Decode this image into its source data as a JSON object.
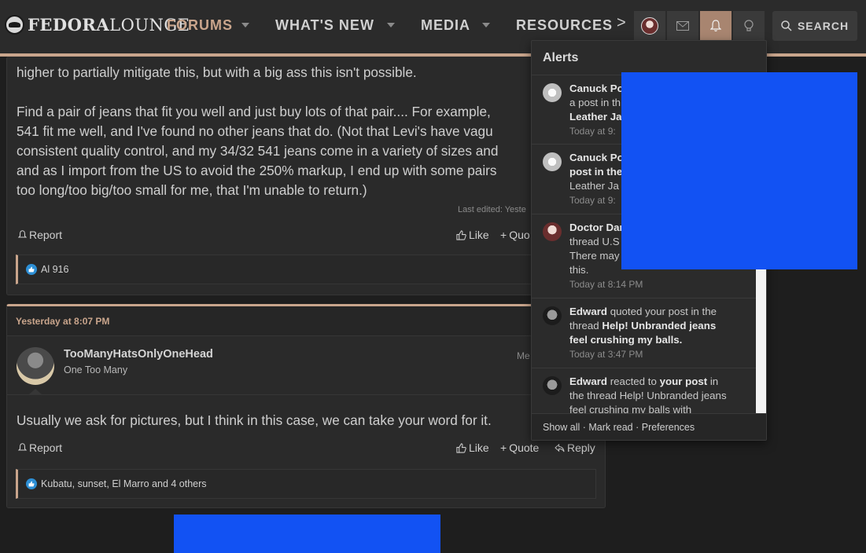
{
  "brand": {
    "logo_part1": "FEDORA",
    "logo_part2": "LOUNGE"
  },
  "nav": {
    "items": [
      "FORUMS",
      "WHAT'S NEW",
      "MEDIA",
      "RESOURCES"
    ],
    "more": ">",
    "search_label": "SEARCH"
  },
  "post1": {
    "lines": [
      "higher to partially mitigate this, but with a big ass this isn't possible.",
      "",
      "Find a pair of jeans that fit you well and just buy lots of that pair.... For example,",
      "541 fit me well, and I've found no other jeans that do. (Not that Levi's have vagu",
      "consistent quality control, and my 34/32 541 jeans come in a variety of sizes and",
      "and as I import from the US to avoid the 250% markup, I end up with some pairs",
      "too long/too big/too small for me, that I'm unable to return.)"
    ],
    "last_edited": "Last edited: Yeste",
    "report": "Report",
    "like": "Like",
    "quote": "Quo",
    "reactions": "Al 916"
  },
  "post2": {
    "date": "Yesterday at 8:07 PM",
    "username": "TooManyHatsOnlyOneHead",
    "user_title": "One Too Many",
    "member_tag": "Me",
    "body": "Usually we ask for pictures, but I think in this case, we can take your word for it.",
    "report": "Report",
    "like": "Like",
    "quote": "Quote",
    "reply": "Reply",
    "reactions": "Kubatu, sunset, El Marro and 4 others"
  },
  "alerts": {
    "title": "Alerts",
    "items": [
      {
        "l1": "Canuck Po",
        "l2": "a post in th",
        "l3": "Leather Ja",
        "time": "Today at 9:"
      },
      {
        "l1": "Canuck Po",
        "l2": "post in the",
        "l3": "Leather Ja",
        "time": "Today at 9:"
      },
      {
        "l1": "Doctor Dar",
        "l2": "thread U.S",
        "l3": "There may",
        "l4": "this.",
        "time": "Today at 8:14 PM"
      },
      {
        "user": "Edward",
        "t1": " quoted your post in the",
        "t2": "thread ",
        "link1": "Help! Unbranded jeans",
        "link2": "feel crushing my balls.",
        "time": "Today at 3:47 PM"
      },
      {
        "user": "Edward",
        "t1": " reacted to ",
        "post": "your post",
        "t2": " in",
        "l2": "the thread Help! Unbranded jeans",
        "l3": "feel crushing my balls with"
      }
    ],
    "footer": "Show all · Mark read · Preferences"
  }
}
